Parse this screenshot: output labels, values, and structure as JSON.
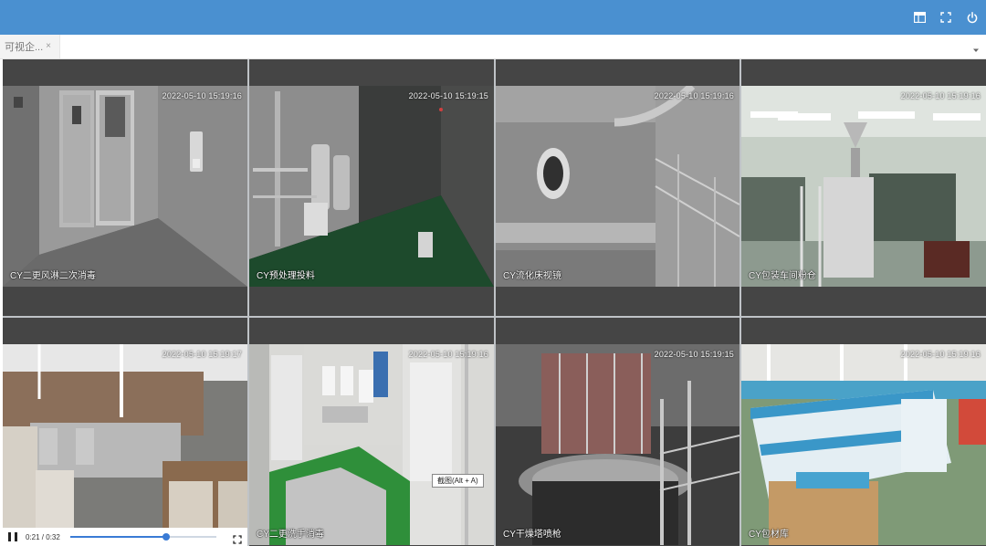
{
  "header": {
    "icons": [
      "layout-icon",
      "fullscreen-icon",
      "power-icon"
    ],
    "bg_color": "#4a90d0"
  },
  "tabs": [
    {
      "label": "可视企...",
      "close": "×"
    }
  ],
  "cameras": [
    {
      "timestamp": "2022-05-10 15:19:16",
      "name": "CY二更风淋二次消毒"
    },
    {
      "timestamp": "2022-05-10 15:19:15",
      "name": "CY预处理投料"
    },
    {
      "timestamp": "2022-05-10 15:19:16",
      "name": "CY流化床视镜"
    },
    {
      "timestamp": "2022-05-10 15:19:16",
      "name": "CY包装车间粉仓"
    },
    {
      "timestamp": "2022-05-10 15:19:17",
      "name": ""
    },
    {
      "timestamp": "2022-05-10 15:19:16",
      "name": "CY二更洗手消毒"
    },
    {
      "timestamp": "2022-05-10 15:19:15",
      "name": "CY干燥塔喷枪"
    },
    {
      "timestamp": "2022-05-10 15:19:16",
      "name": "CY包材库"
    }
  ],
  "player": {
    "time": "0:21 / 0:32",
    "progress": 0.656
  },
  "tooltip": {
    "text": "截图(Alt + A)"
  }
}
